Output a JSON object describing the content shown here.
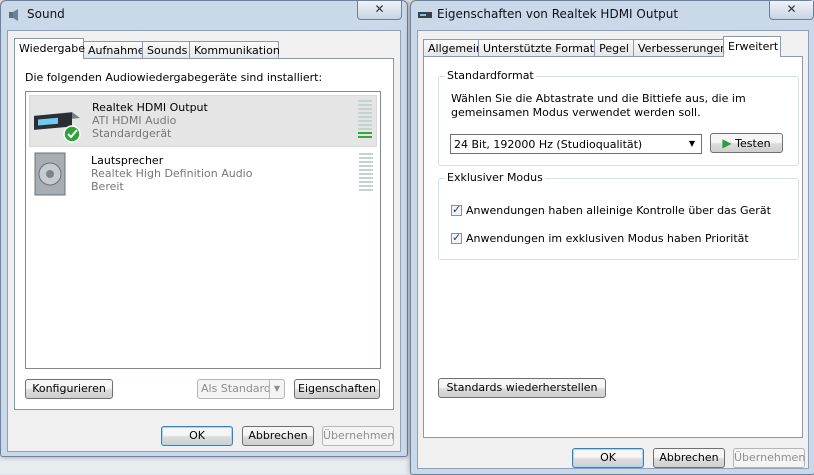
{
  "sound_window": {
    "title": "Sound",
    "tabs": [
      "Wiedergabe",
      "Aufnahme",
      "Sounds",
      "Kommunikation"
    ],
    "instruction": "Die folgenden Audiowiedergabegeräte sind installiert:",
    "devices": [
      {
        "name": "Realtek HDMI Output",
        "description": "ATI HDMI Audio",
        "status": "Standardgerät"
      },
      {
        "name": "Lautsprecher",
        "description": "Realtek High Definition Audio",
        "status": "Bereit"
      }
    ],
    "buttons": {
      "configure": "Konfigurieren",
      "set_default": "Als Standard",
      "properties": "Eigenschaften",
      "ok": "OK",
      "cancel": "Abbrechen",
      "apply": "Übernehmen"
    }
  },
  "props_window": {
    "title": "Eigenschaften von Realtek HDMI Output",
    "tabs": [
      "Allgemein",
      "Unterstützte Formate",
      "Pegel",
      "Verbesserungen",
      "Erweitert"
    ],
    "default_format": {
      "label": "Standardformat",
      "description": "Wählen Sie die Abtastrate und die Bittiefe aus, die im gemeinsamen Modus verwendet werden soll.",
      "selected": "24 Bit, 192000 Hz (Studioqualität)",
      "test_button": "Testen"
    },
    "exclusive_mode": {
      "label": "Exklusiver Modus",
      "option1": "Anwendungen haben alleinige Kontrolle über das Gerät",
      "option2": "Anwendungen im exklusiven Modus haben Priorität"
    },
    "restore_button": "Standards wiederherstellen",
    "buttons": {
      "ok": "OK",
      "cancel": "Abbrechen",
      "apply": "Übernehmen"
    }
  },
  "colors": {
    "accent_green": "#38a63c",
    "title_bar": "#c9d9ea"
  }
}
